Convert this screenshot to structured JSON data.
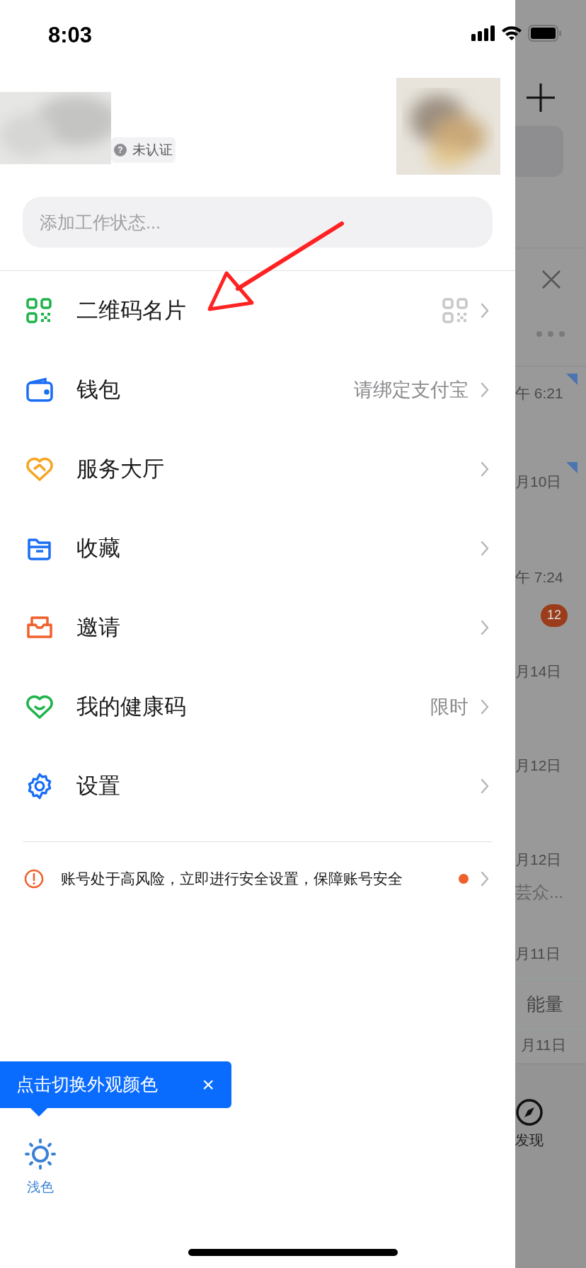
{
  "status_bar": {
    "time": "8:03"
  },
  "profile": {
    "badge_icon": "?",
    "badge": "未认证",
    "status_placeholder": "添加工作状态..."
  },
  "menu": [
    {
      "label": "二维码名片",
      "kind": "qr"
    },
    {
      "label": "钱包",
      "value": "请绑定支付宝",
      "kind": "plain"
    },
    {
      "label": "服务大厅",
      "kind": "plain"
    },
    {
      "label": "收藏",
      "kind": "plain"
    },
    {
      "label": "邀请",
      "kind": "plain"
    },
    {
      "label": "我的健康码",
      "value": "限时",
      "kind": "plain"
    },
    {
      "label": "设置",
      "kind": "plain"
    }
  ],
  "alert": {
    "text": "账号处于高风险，立即进行安全设置，保障账号安全",
    "unread": true
  },
  "tooltip": {
    "text": "点击切换外观颜色",
    "close": "×"
  },
  "theme_button": {
    "label": "浅色"
  },
  "background": {
    "rows": [
      {
        "time": "午 6:21",
        "flag": true
      },
      {
        "time": "月10日",
        "flag": true
      },
      {
        "time": "午 7:24",
        "flag": false,
        "badge": "12"
      },
      {
        "time": "月14日",
        "flag": false
      },
      {
        "time": "月12日",
        "flag": false
      },
      {
        "time": "月12日",
        "flag": false,
        "preview": "芸众..."
      },
      {
        "time": "月11日",
        "flag": false
      }
    ],
    "banner": "能量",
    "last_time": "月11日",
    "tab": "发现"
  }
}
